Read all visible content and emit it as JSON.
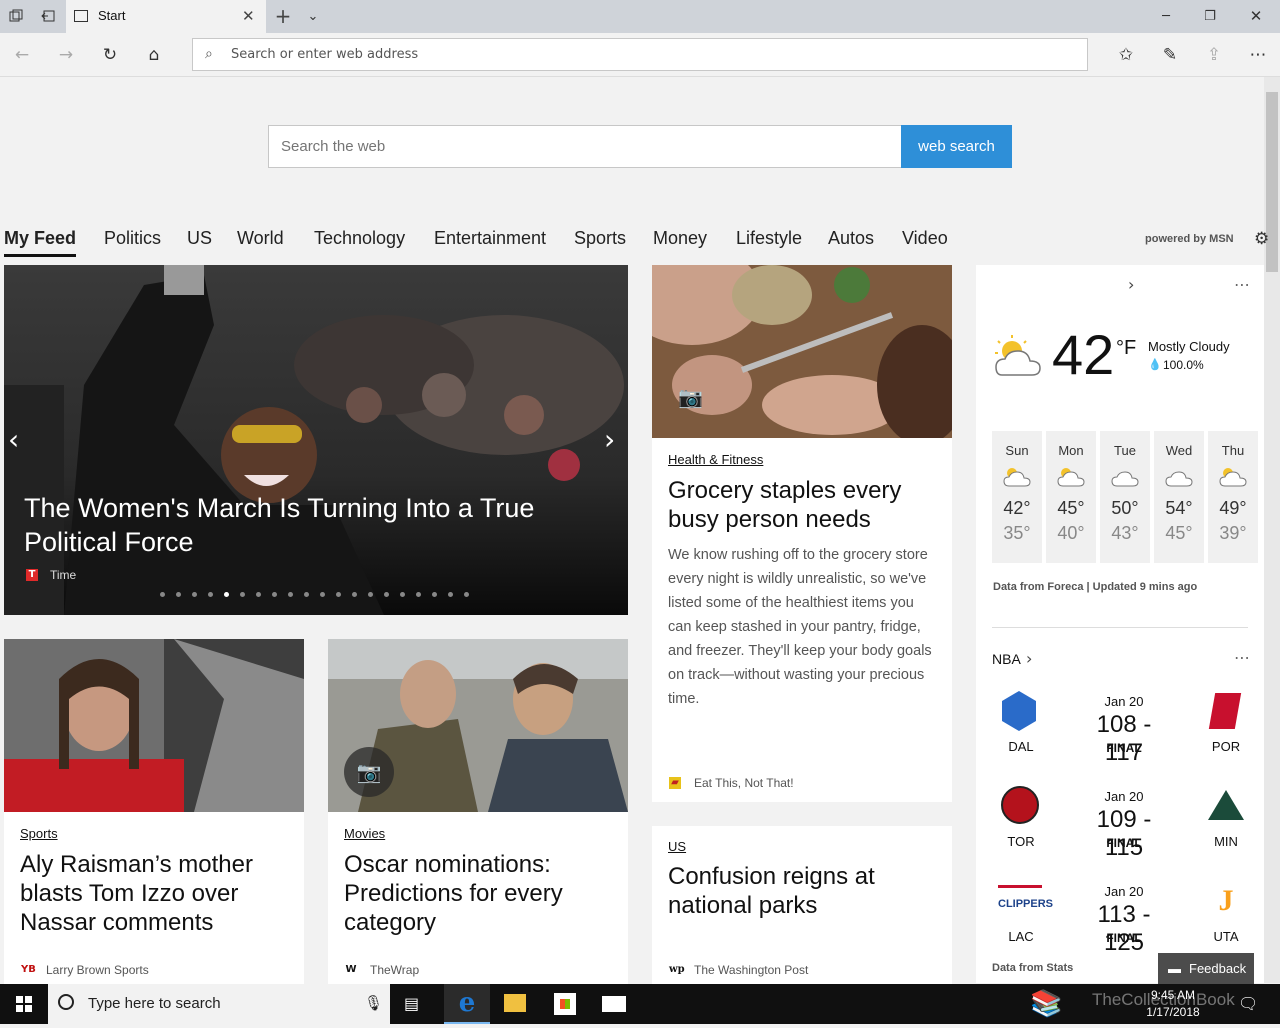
{
  "browser": {
    "tab_title": "Start",
    "address_placeholder": "Search or enter web address"
  },
  "search": {
    "placeholder": "Search the web",
    "button_label": "web search"
  },
  "feed_tabs": [
    "My Feed",
    "Politics",
    "US",
    "World",
    "Technology",
    "Entertainment",
    "Sports",
    "Money",
    "Lifestyle",
    "Autos",
    "Video"
  ],
  "powered_by": "powered by MSN",
  "hero": {
    "title": "The Women's March Is Turning Into a True Political Force",
    "source": "Time",
    "slide_count": 20,
    "active_slide": 4
  },
  "cards": {
    "grocery": {
      "category": "Health & Fitness",
      "title": "Grocery staples every busy person needs",
      "body": "We know rushing off to the grocery store every night is wildly unrealistic, so we've listed some of the healthiest items you can keep stashed in your pantry, fridge, and freezer. They'll keep your body goals on track—without wasting your precious time.",
      "source": "Eat This, Not That!"
    },
    "raisman": {
      "category": "Sports",
      "title": "Aly Raisman’s mother blasts Tom Izzo over Nassar comments",
      "source": "Larry Brown Sports"
    },
    "oscar": {
      "category": "Movies",
      "title": "Oscar nominations: Predictions for every category",
      "source": "TheWrap"
    },
    "parks": {
      "category": "US",
      "title": "Confusion reigns at national parks",
      "source": "The Washington Post"
    }
  },
  "weather": {
    "temp": "42",
    "unit": "°F",
    "condition": "Mostly Cloudy",
    "precip": "100.0%",
    "forecast": [
      {
        "day": "Sun",
        "hi": "42°",
        "lo": "35°",
        "icon": "partly-sunny-icon"
      },
      {
        "day": "Mon",
        "hi": "45°",
        "lo": "40°",
        "icon": "partly-sunny-icon"
      },
      {
        "day": "Tue",
        "hi": "50°",
        "lo": "43°",
        "icon": "cloud-icon"
      },
      {
        "day": "Wed",
        "hi": "54°",
        "lo": "45°",
        "icon": "cloud-icon"
      },
      {
        "day": "Thu",
        "hi": "49°",
        "lo": "39°",
        "icon": "partly-sunny-icon"
      }
    ],
    "footer": "Data from Foreca | Updated 9 mins ago"
  },
  "nba": {
    "title": "NBA",
    "games": [
      {
        "date": "Jan 20",
        "score": "108 - 117",
        "status": "FINAL",
        "away": "DAL",
        "home": "POR"
      },
      {
        "date": "Jan 20",
        "score": "109 - 115",
        "status": "FINAL",
        "away": "TOR",
        "home": "MIN"
      },
      {
        "date": "Jan 20",
        "score": "113 - 125",
        "status": "FINAL",
        "away": "LAC",
        "home": "UTA"
      }
    ],
    "footer": "Data from Stats"
  },
  "feedback_label": "Feedback",
  "taskbar": {
    "search_placeholder": "Type here to search",
    "time": "9:45 AM",
    "date": "1/17/2018"
  },
  "watermark": "TheCollectionBook",
  "colors": {
    "accent": "#2e8fd8",
    "edge_blue": "#1e78d2"
  }
}
